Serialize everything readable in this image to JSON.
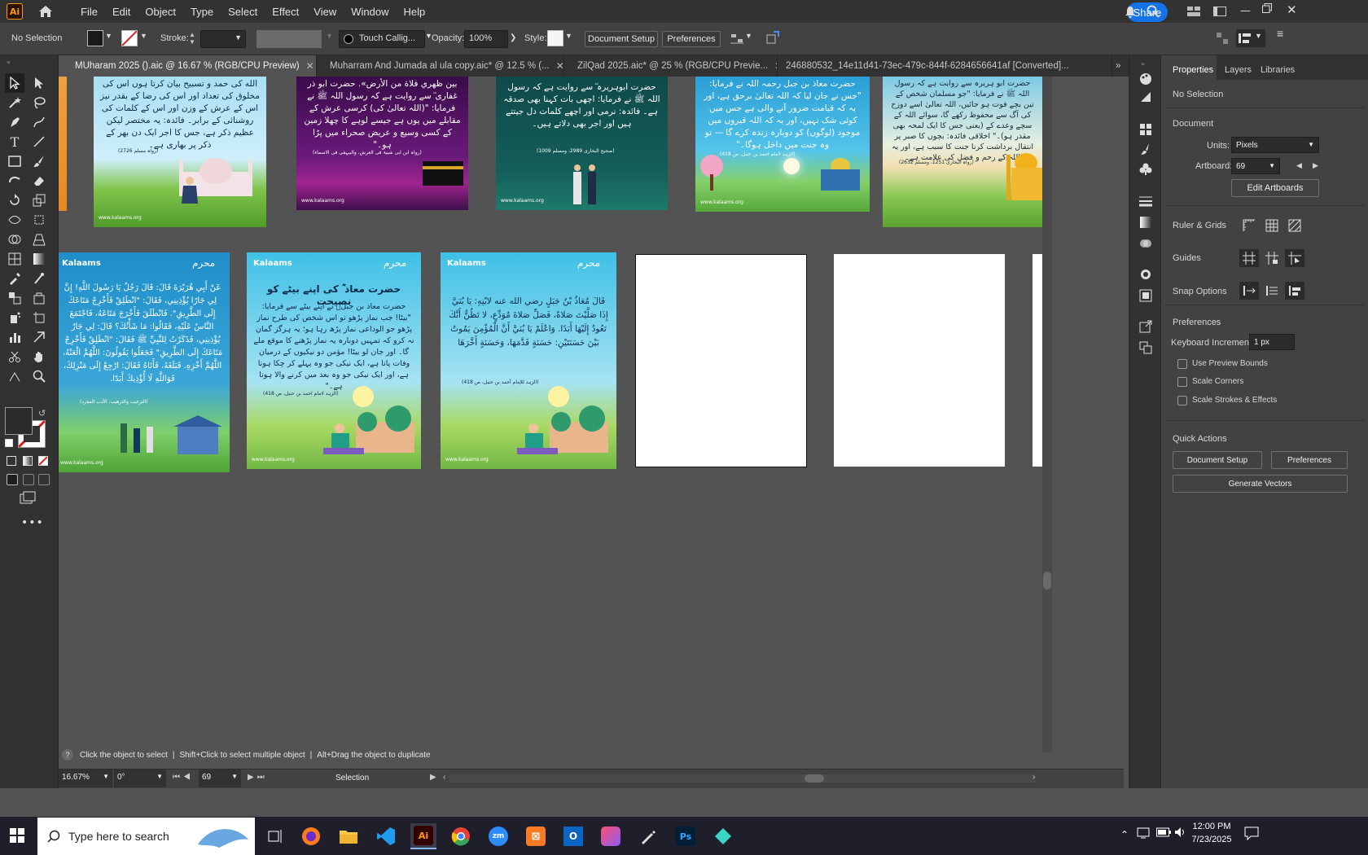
{
  "menubar": {
    "app_logo": "Ai",
    "items": [
      "File",
      "Edit",
      "Object",
      "Type",
      "Select",
      "Effect",
      "View",
      "Window",
      "Help"
    ],
    "share_label": "Share"
  },
  "controlbar": {
    "selection": "No Selection",
    "stroke_label": "Stroke:",
    "brush": "Touch Callig...",
    "opacity_label": "Opacity:",
    "opacity_value": "100%",
    "style_label": "Style:",
    "document_setup": "Document Setup",
    "preferences": "Preferences"
  },
  "tabs": [
    {
      "label": "MUharam 2025 ().aic @ 16.67 % (RGB/CPU Preview)",
      "active": true
    },
    {
      "label": "Muharram And Jumada al ula copy.aic* @ 12.5 % (...",
      "active": false
    },
    {
      "label": "ZilQad 2025.aic* @ 25 % (RGB/CPU Previe...",
      "active": false
    },
    {
      "label": "246880532_14e11d41-73ec-479c-844f-6284656641af [Converted]...",
      "active": false
    }
  ],
  "artboards_top": [
    {
      "text": "الله کی حمد و تسبیح بیان کرتا ہوں اس کی مخلوق کی تعداد اور اس کی رضا کے بقدر نیز اس کے عرش کے وزن اور اس کے کلمات کی روشنائی کے برابر۔\nفائدہ: یہ مختصر لیکن عظیم ذکر ہے، جس کا اجر ایک دن بھر کے ذکر پر بھاری ہے۔",
      "ref": "(رواہ مسلم 2726)",
      "url": "www.kalaams.org"
    },
    {
      "text": "بین ظهري فلاة من الأرض».\nحضرت ابو ذر غفاری ؓ سے روایت ہے کہ رسول اللہ ﷺ نے فرمایا: \"(اللہ تعالیٰ کی) کرسی عرش کے مقابلے میں یوں ہے جیسے لوہے کا چھلا زمین کے کسی وسیع و عریض صحراء میں پڑا ہو۔\"",
      "ref": "(رواہ ابن ابی شیبۃ فی العرش، والبیہقی فی الاسماء)",
      "url": "www.kalaams.org"
    },
    {
      "text": "حضرت ابوہریرہ ؓ سے روایت ہے کہ رسول اللہ ﷺ نے فرمایا: اچھی بات کہنا بھی صدقہ ہے۔\nفائدہ: نرمی اور اچھے کلمات دل جیتتے ہیں اور اجر بھی دلاتے ہیں۔",
      "ref": "(صحیح البخاری 2989، ومسلم 1009)",
      "url": "www.kalaams.org"
    },
    {
      "text": "حضرت معاذ بن جبل رحمہ اللہ نے فرمایا: \"جس نے جان لیا کہ اللہ تعالیٰ برحق ہے، اور یہ کہ قیامت ضرور آنے والی ہے جس میں کوئی شک نہیں، اور یہ کہ اللہ قبروں میں موجود (لوگوں) کو دوبارہ زندہ کرے گا — تو وہ جنت میں داخل ہوگا۔\"",
      "ref": "(الزہد لامام احمد بن حنبل، ص 418)",
      "url": "www.kalaams.org"
    },
    {
      "text": "حضرت ابو ہریرہ سے روایت ہے کہ رسول اللہ ﷺ نے فرمایا: \"جو مسلمان شخص کے تین بچے فوت ہو جائیں، اللہ تعالیٰ اسے دوزخ کی آگ سے محفوظ رکھے گا، سوائے اللہ کے سچے وعدے کے (یعنی جس کا ایک لمحہ بھی مقدر ہو)۔\"\nاخلاقی فائدہ: بچوں کا صبر پر انتقال برداشت کرنا جنت کا سبب ہے، اور یہ اللہ کے رحم و فضل کی علامت ہے۔",
      "ref": "(رواہ البخاری 1251، ومسلم 2632)",
      "url": "www.kalaams.org"
    }
  ],
  "artboards_bottom": [
    {
      "brand": "Kalaams",
      "title": "",
      "text": "عَنْ أَبِي هُرَيْرَةَ قَالَ: قَالَ رَجُلٌ يَا رَسُولَ اللَّهِ! إِنَّ لِي جَارًا يُؤْذِينِي، فَقَالَ: \"انْطَلِقْ فَأَخْرِجْ مَتَاعَكَ إِلَى الطَّرِيقِ\". فَانْطَلَقَ فَأَخْرَجَ مَتَاعَهُ، فَاجْتَمَعَ النَّاسُ عَلَيْهِ، فَقَالُوا: مَا شَأْنُكَ؟ قَالَ: لِي جَارٌ يُؤْذِينِي، فَذَكَرْتُ لِلنَّبِيِّ ﷺ فَقَالَ: \"انْطَلِقْ فَأَخْرِجْ مَتَاعَكَ إِلَى الطَّرِيقِ\" فَجَعَلُوا يَقُولُونَ: اللَّهُمَّ الْعَنْهُ، اللَّهُمَّ أَخْزِهِ. فَبَلَغَهُ، فَأَتَاهُ فَقَالَ: ارْجِعْ إِلَى مَنْزِلِكَ، فَوَاللَّهِ لَا أُؤْذِيكَ أَبَدًا.",
      "ref": "(الترغيب والترهيب، الأدب المفرد)",
      "url": "www.kalaams.org"
    },
    {
      "brand": "Kalaams",
      "title": "حضرت معاذ ؓ کی اپنے بیٹے کو نصیحت",
      "text": "حضرت معاذ بن جبلؓ نے اپنے بیٹے سے فرمایا: \"بیٹا! جب نماز پڑھو تو اس شخص کی طرح نماز پڑھو جو الوداعی نماز پڑھ رہا ہو؛ یہ ہرگز گمان نہ کرو کہ تمہیں دوبارہ یہ نماز پڑھنے کا موقع ملے گا۔ اور جان لو بیٹا! مؤمن دو نیکیوں کے درمیان وفات پاتا ہے، ایک نیکی جو وہ پہلے کر چکا ہوتا ہے، اور ایک نیکی جو وہ بعد میں کرنے والا ہوتا ہے۔\"",
      "ref": "(الزہد لامام احمد بن حنبل، ص 418)",
      "url": "www.kalaams.org"
    },
    {
      "brand": "Kalaams",
      "title": "",
      "text": "قَالَ مُعَاذُ بْنُ جَبَلٍ رضي الله عنه لابْنِهِ: يَا بُنَيَّ إِذَا صَلَّيْتَ صَلاةً، فَصَلِّ صَلاةَ مُوَدِّعٍ، لا تَظُنُّ أَنَّكَ تَعُودُ إِلَيْهَا أَبَدًا. وَاعْلَمْ يَا بُنَيَّ أَنَّ الْمُؤْمِنَ يَمُوتُ بَيْنَ حَسَنَتَيْنِ: حَسَنَةٍ قَدَّمَهَا، وَحَسَنَةٍ أَخَّرَهَا",
      "ref": "(الزہد للإمام أحمد بن حنبل، ص 418)",
      "url": "www.kalaams.org"
    }
  ],
  "properties": {
    "tabs": [
      "Properties",
      "Layers",
      "Libraries"
    ],
    "selection": "No Selection",
    "document_heading": "Document",
    "units_label": "Units:",
    "units_value": "Pixels",
    "artboard_label": "Artboard:",
    "artboard_value": "69",
    "edit_artboards": "Edit Artboards",
    "ruler_grids": "Ruler & Grids",
    "guides": "Guides",
    "snap_options": "Snap Options",
    "preferences_heading": "Preferences",
    "keyboard_increment_label": "Keyboard Increment:",
    "keyboard_increment_value": "1 px",
    "use_preview_bounds": "Use Preview Bounds",
    "scale_corners": "Scale Corners",
    "scale_strokes": "Scale Strokes & Effects",
    "quick_actions": "Quick Actions",
    "document_setup": "Document Setup",
    "preferences_btn": "Preferences",
    "generate_vectors": "Generate Vectors"
  },
  "statusbar": {
    "hint_click": "Click the object to select",
    "hint_shift": "Shift+Click to select multiple object",
    "hint_alt": "Alt+Drag the object to duplicate",
    "zoom": "16.67%",
    "rotation": "0°",
    "artboard_nav": "69",
    "tool": "Selection"
  },
  "taskbar": {
    "search_placeholder": "Type here to search",
    "time": "12:00 PM",
    "date": "7/23/2025"
  }
}
